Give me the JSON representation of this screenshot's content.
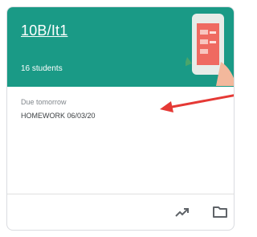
{
  "card": {
    "class_name": "10B/It1",
    "student_count": "16 students",
    "due_label": "Due tomorrow",
    "assignment": "HOMEWORK 06/03/20"
  },
  "icons": {
    "header": "phone-illustration",
    "annotation": "red-arrow-icon",
    "footer": [
      "trending-up-icon",
      "folder-icon"
    ]
  },
  "colors": {
    "header_bg": "#1a9a86",
    "annotation": "#e53935"
  }
}
